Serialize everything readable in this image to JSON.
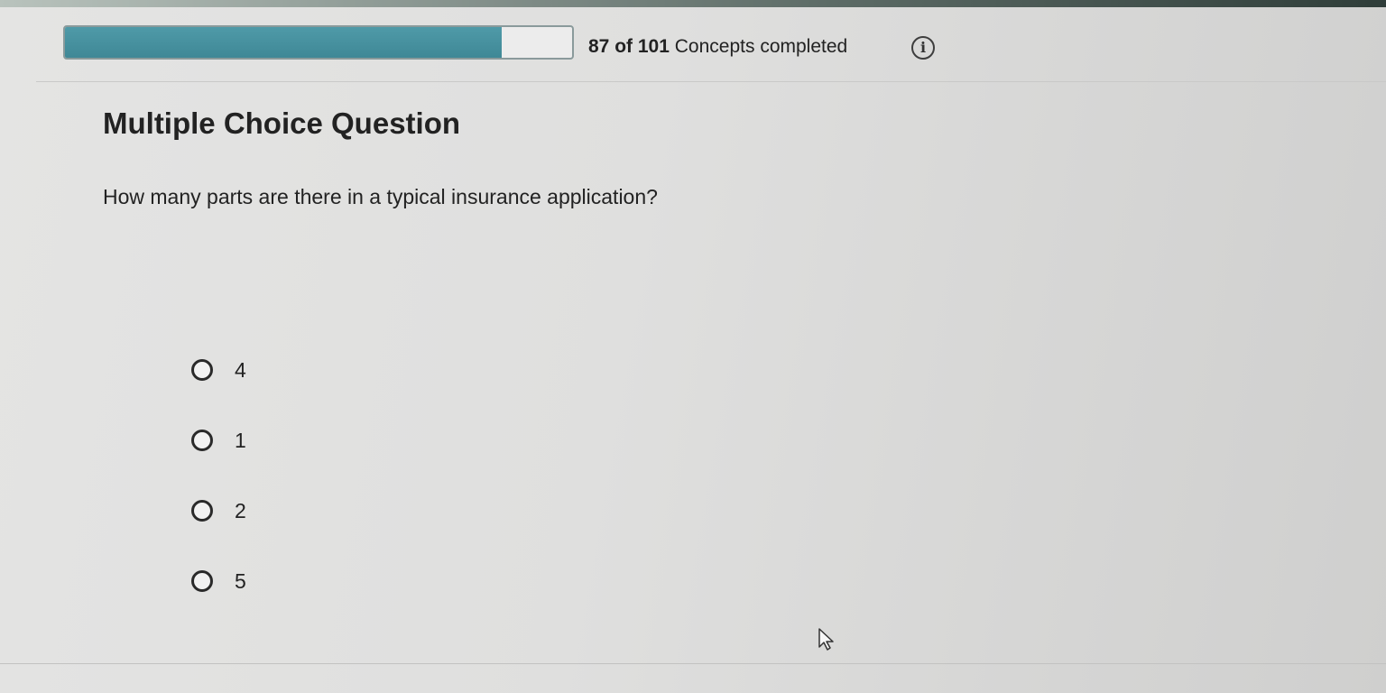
{
  "progress": {
    "completed": "87",
    "of_word": "of",
    "total": "101",
    "suffix": "Concepts completed",
    "fraction": 0.861
  },
  "info_icon": {
    "glyph": "i",
    "name": "info-icon"
  },
  "question": {
    "type": "Multiple Choice Question",
    "text": "How many parts are there in a typical insurance application?"
  },
  "choices": [
    {
      "label": "4"
    },
    {
      "label": "1"
    },
    {
      "label": "2"
    },
    {
      "label": "5"
    }
  ],
  "colors": {
    "progress_fill": "#3f8896",
    "progress_border": "#8a9a9b",
    "text": "#222222"
  }
}
